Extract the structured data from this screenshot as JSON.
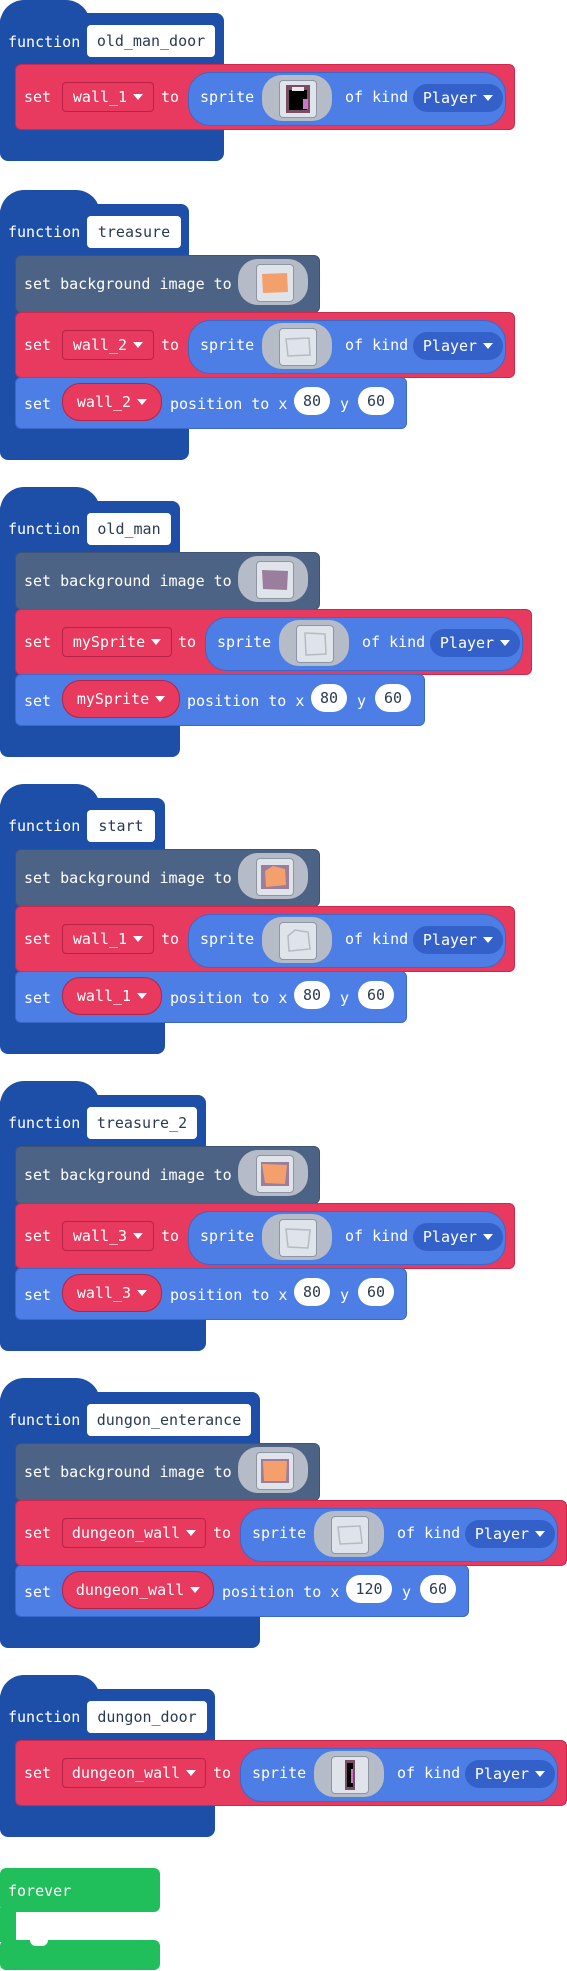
{
  "labels": {
    "function": "function",
    "set": "set",
    "to": "to",
    "sprite": "sprite",
    "of_kind": "of kind",
    "set_background_image_to": "set background image to",
    "position_to_x": "position to x",
    "y": "y",
    "forever": "forever"
  },
  "blocks": [
    {
      "name": "old_man_door",
      "var": "wall_1",
      "kind": "Player"
    },
    {
      "name": "treasure",
      "var": "wall_2",
      "kind": "Player",
      "x": "80",
      "y": "60"
    },
    {
      "name": "old_man",
      "var": "mySprite",
      "kind": "Player",
      "x": "80",
      "y": "60"
    },
    {
      "name": "start",
      "var": "wall_1",
      "kind": "Player",
      "x": "80",
      "y": "60"
    },
    {
      "name": "treasure_2",
      "var": "wall_3",
      "kind": "Player",
      "x": "80",
      "y": "60"
    },
    {
      "name": "dungon_enterance",
      "var": "dungeon_wall",
      "kind": "Player",
      "x": "120",
      "y": "60"
    },
    {
      "name": "dungon_door",
      "var": "dungeon_wall",
      "kind": "Player"
    }
  ],
  "colors": {
    "function_block": "#1e4fa8",
    "set_block": "#e8395e",
    "scene_block": "#4d6385",
    "sprite_block": "#4c7ee6",
    "forever_block": "#21bf5b"
  }
}
